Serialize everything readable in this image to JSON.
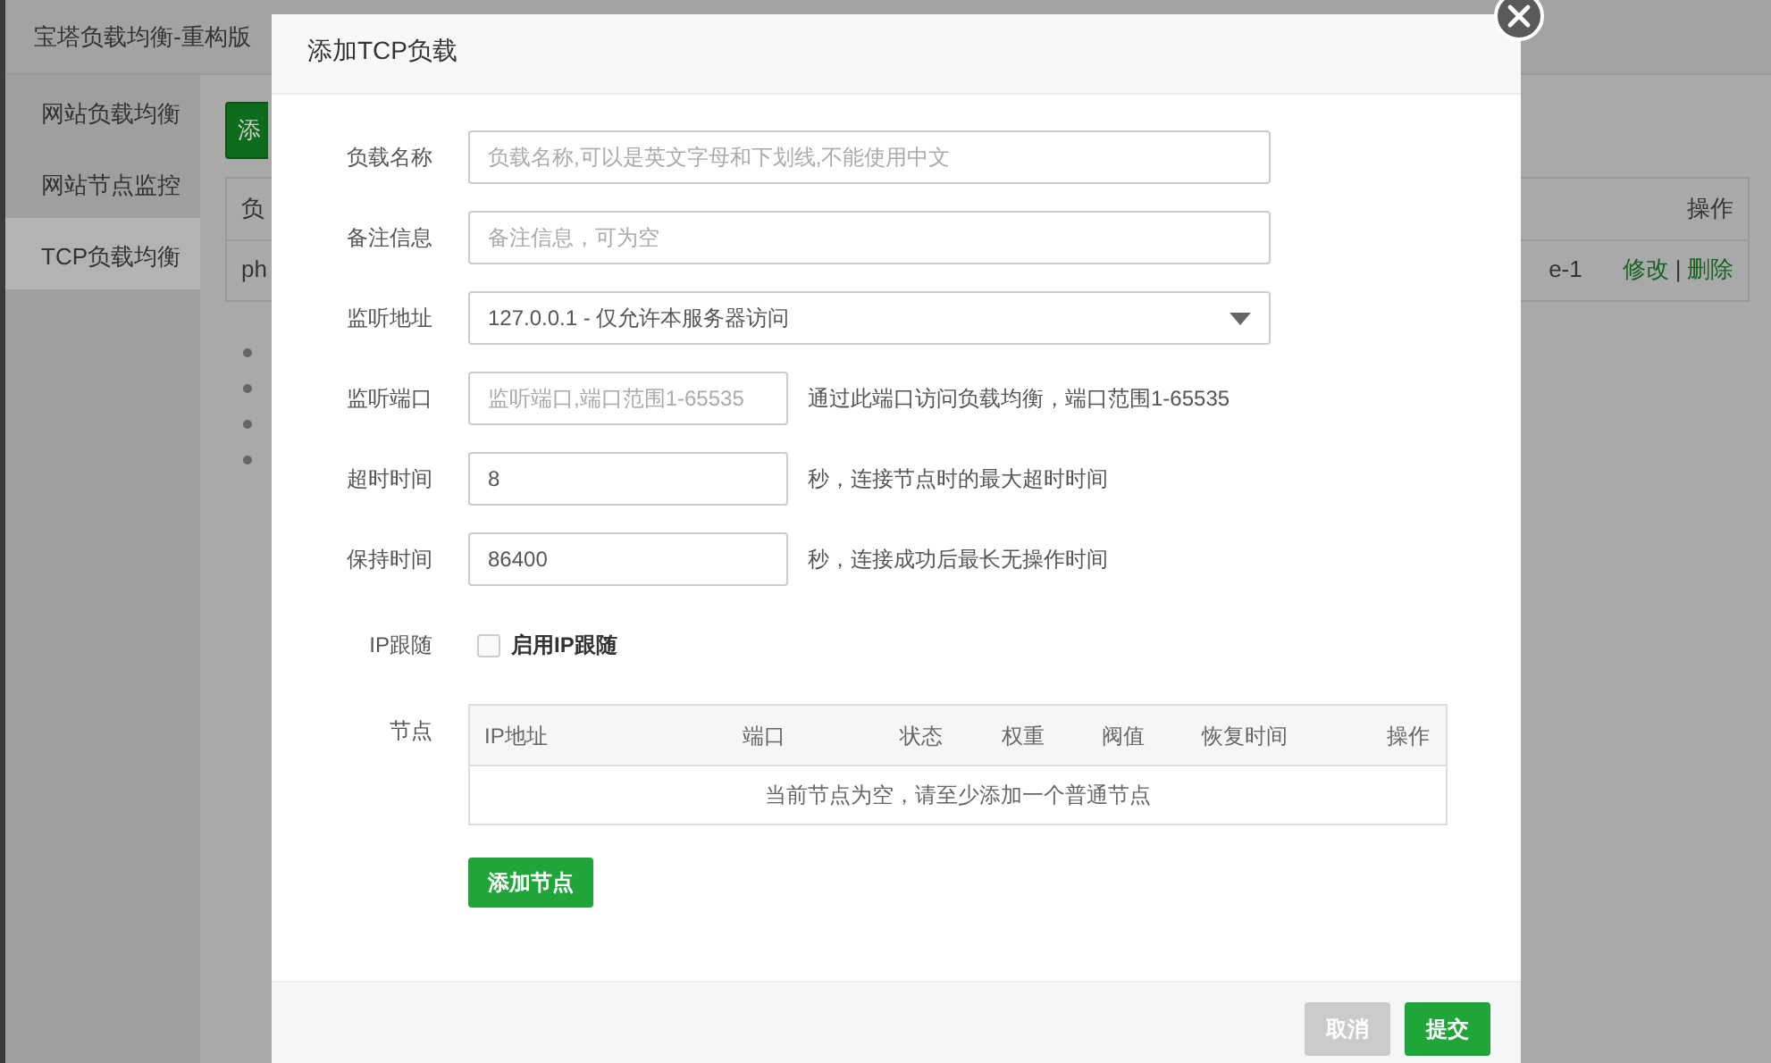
{
  "app": {
    "title": "宝塔负载均衡-重构版",
    "sidebar": [
      {
        "label": "网站负载均衡",
        "selected": false
      },
      {
        "label": "网站节点监控",
        "selected": false
      },
      {
        "label": "TCP负载均衡",
        "selected": true
      }
    ],
    "add_button": "添",
    "table": {
      "header_first": "负",
      "header_last": "操作",
      "cell_first": "ph",
      "cell_last": "e-1",
      "actions": [
        "修改",
        "|",
        "删除"
      ]
    }
  },
  "modal": {
    "title": "添加TCP负载",
    "fields": [
      {
        "kind": "text",
        "label": "负载名称",
        "placeholder": "负载名称,可以是英文字母和下划线,不能使用中文"
      },
      {
        "kind": "text",
        "label": "备注信息",
        "placeholder": "备注信息，可为空"
      },
      {
        "kind": "select",
        "label": "监听地址",
        "value": "127.0.0.1 - 仅允许本服务器访问"
      },
      {
        "kind": "text",
        "label": "监听端口",
        "placeholder": "监听端口,端口范围1-65535",
        "hint": "通过此端口访问负载均衡，端口范围1-65535"
      },
      {
        "kind": "text",
        "label": "超时时间",
        "value": "8",
        "hint": "秒，连接节点时的最大超时时间"
      },
      {
        "kind": "text",
        "label": "保持时间",
        "value": "86400",
        "hint": "秒，连接成功后最长无操作时间"
      },
      {
        "kind": "checkbox",
        "label": "IP跟随",
        "option": "启用IP跟随",
        "checked": false
      }
    ],
    "nodes": {
      "label": "节点",
      "columns": [
        "IP地址",
        "端口",
        "状态",
        "权重",
        "阀值",
        "恢复时间",
        "操作"
      ],
      "empty": "当前节点为空，请至少添加一个普通节点",
      "add_button": "添加节点"
    },
    "buttons": [
      {
        "label": "取消",
        "kind": "secondary"
      },
      {
        "label": "提交",
        "kind": "primary"
      }
    ]
  }
}
